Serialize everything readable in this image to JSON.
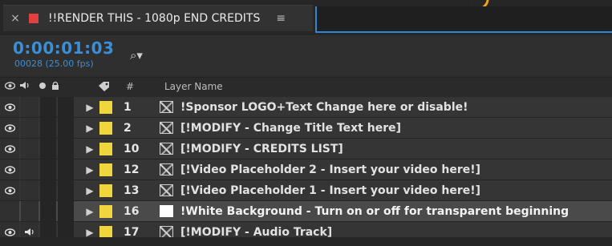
{
  "tab": {
    "close_icon": "×",
    "title": "!!RENDER THIS - 1080p END CREDITS",
    "menu_icon": "≡",
    "swatch_color": "#e04040"
  },
  "time": {
    "timecode": "0:00:01:03",
    "frames": "00028 (25.00 fps)",
    "search_icon": "⌕▾"
  },
  "header": {
    "icons": [
      "eye-icon",
      "speaker-icon",
      "solo-icon",
      "lock-icon",
      "label-tag-icon"
    ],
    "num": "#",
    "layer_name": "Layer Name"
  },
  "colors": {
    "accent": "#3a8fd9",
    "label_yellow": "#eed63c",
    "selected_row": "#4a4a4a"
  },
  "layers": [
    {
      "num": "1",
      "name": "!Sponsor LOGO+Text Change here or disable!",
      "visible": true,
      "audio": false,
      "icon": "comp",
      "selected": false
    },
    {
      "num": "2",
      "name": "[!MODIFY - Change Title Text  here]",
      "visible": true,
      "audio": false,
      "icon": "comp",
      "selected": false
    },
    {
      "num": "10",
      "name": "[!MODIFY - CREDITS LIST]",
      "visible": true,
      "audio": false,
      "icon": "comp",
      "selected": false
    },
    {
      "num": "12",
      "name": "[!Video Placeholder 2 - Insert your video here!]",
      "visible": true,
      "audio": false,
      "icon": "comp",
      "selected": false
    },
    {
      "num": "13",
      "name": "[!Video Placeholder 1 - Insert your video here!]",
      "visible": true,
      "audio": false,
      "icon": "comp",
      "selected": false
    },
    {
      "num": "16",
      "name": "!White Background - Turn on or off for transparent beginning",
      "visible": false,
      "audio": false,
      "icon": "solid",
      "selected": true
    },
    {
      "num": "17",
      "name": "[!MODIFY - Audio Track]",
      "visible": true,
      "audio": true,
      "icon": "comp",
      "selected": false
    }
  ]
}
